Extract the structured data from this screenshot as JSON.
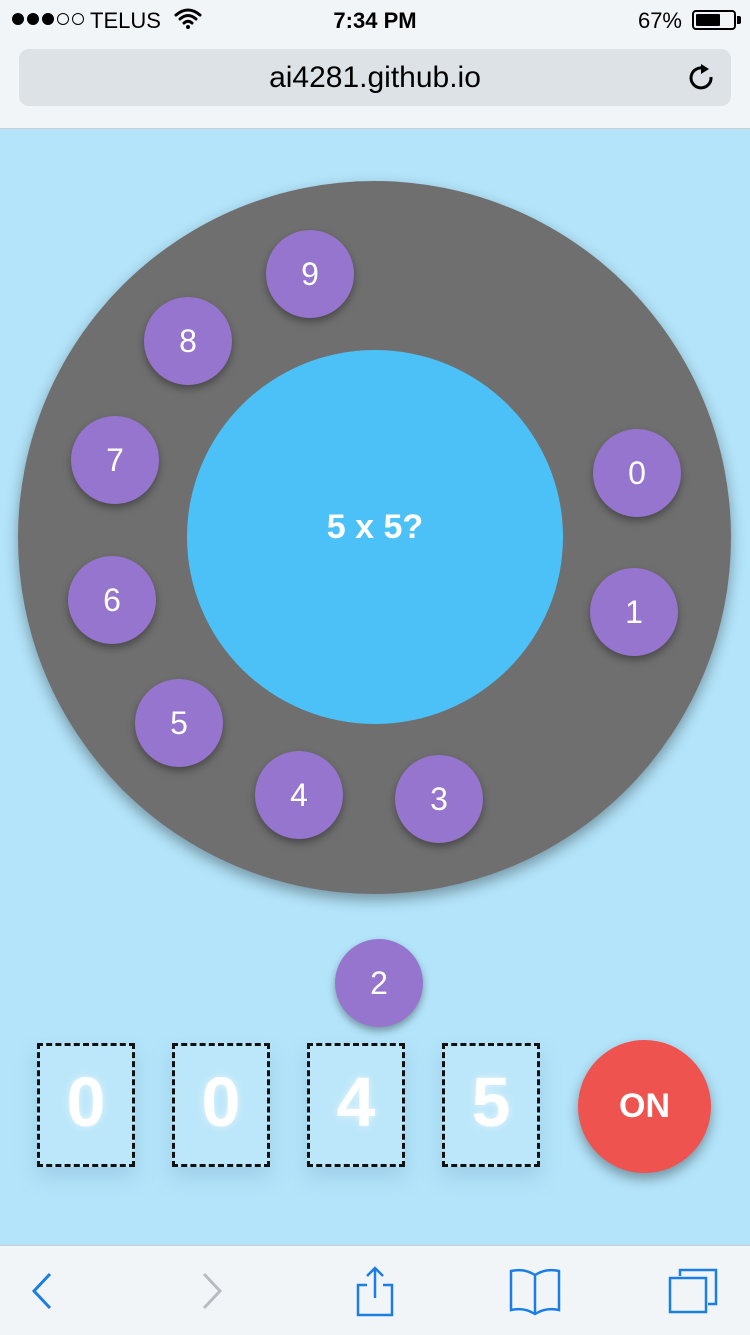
{
  "status_bar": {
    "carrier": "TELUS",
    "signal_dots_filled": 3,
    "signal_dots_total": 5,
    "time": "7:34 PM",
    "battery_percent": "67%",
    "battery_level": 0.67
  },
  "browser": {
    "url": "ai4281.github.io",
    "reload_icon": "reload-icon"
  },
  "dial": {
    "question": "5 x 5?",
    "digits": [
      "0",
      "1",
      "2",
      "3",
      "4",
      "5",
      "6",
      "7",
      "8",
      "9"
    ]
  },
  "display": {
    "digits": [
      "0",
      "0",
      "4",
      "5"
    ],
    "power_label": "ON"
  },
  "toolbar": {
    "items": [
      "back-icon",
      "forward-icon",
      "share-icon",
      "bookmarks-icon",
      "tabs-icon"
    ]
  },
  "colors": {
    "page_background": "#b3e4fa",
    "dial": "#6f6f6f",
    "dial_center": "#4cc1f7",
    "digit_button": "#9575cd",
    "on_button": "#ef5350",
    "ios_blue": "#1a7ee6"
  }
}
